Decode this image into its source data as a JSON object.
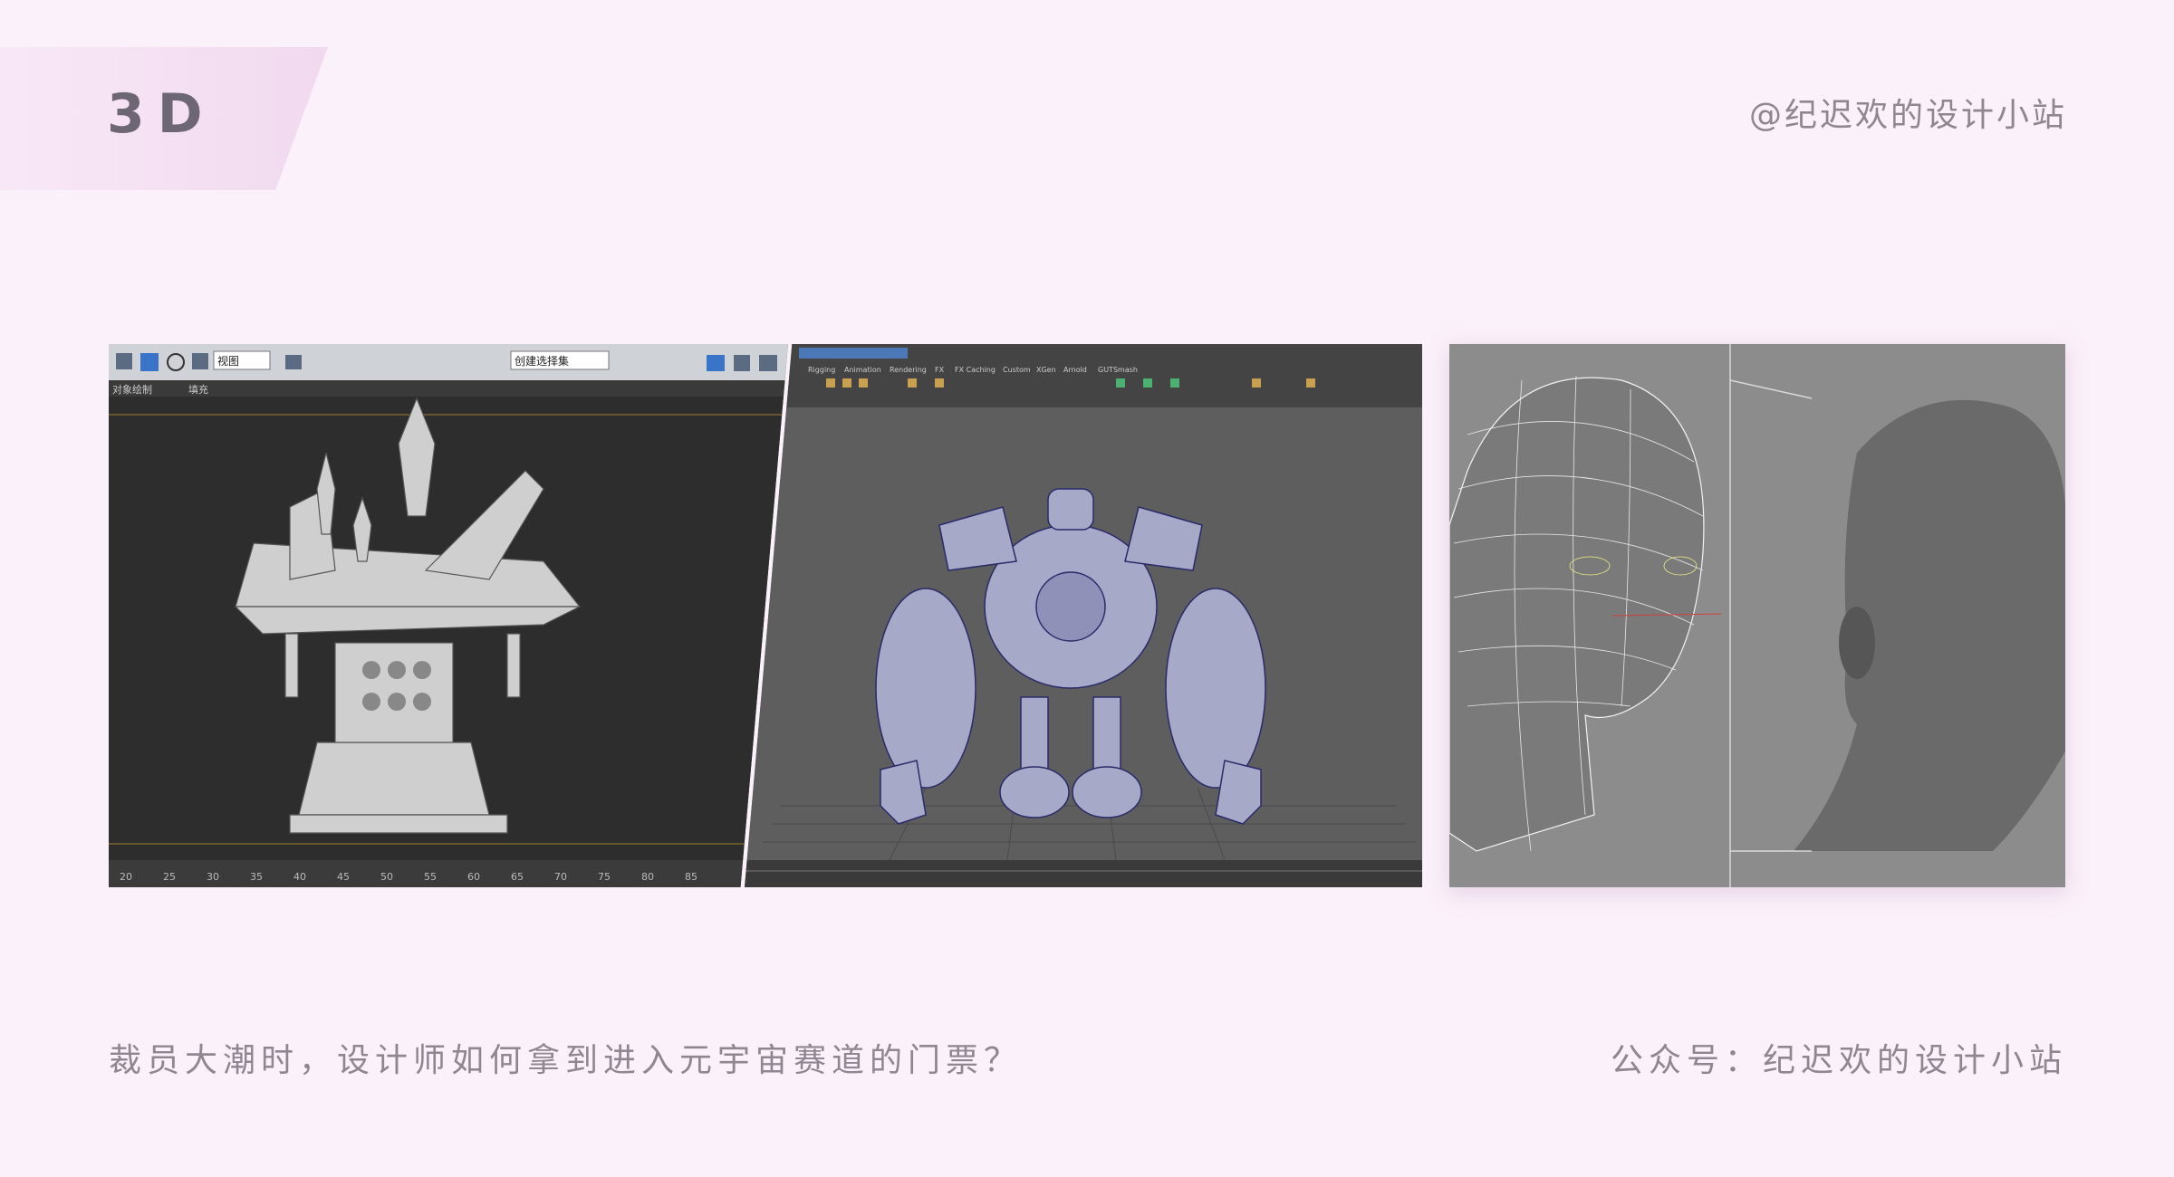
{
  "section_tag": "3D",
  "handle": "@纪迟欢的设计小站",
  "caption": "裁员大潮时，设计师如何拿到进入元宇宙赛道的门票？",
  "account": "公众号：纪迟欢的设计小站",
  "screens": [
    {
      "id": "max-temple",
      "toolbar_dropdown": "视图",
      "toolbar_dropdown2": "创建选择集",
      "menu_items": [
        "对象绘制",
        "填充"
      ],
      "ruler_ticks": [
        "20",
        "25",
        "30",
        "35",
        "40",
        "45",
        "50",
        "55",
        "60",
        "65",
        "70",
        "75",
        "80",
        "85"
      ]
    },
    {
      "id": "maya-robot",
      "menu_items": [
        "Rigging",
        "Animation",
        "Rendering",
        "FX",
        "FX Caching",
        "Custom",
        "XGen",
        "Arnold",
        "GUTSmash"
      ]
    },
    {
      "id": "head-wireframe"
    }
  ],
  "colors": {
    "accent": "#f1d9ef",
    "text": "#8e8690",
    "background": "#fbf1fa"
  }
}
